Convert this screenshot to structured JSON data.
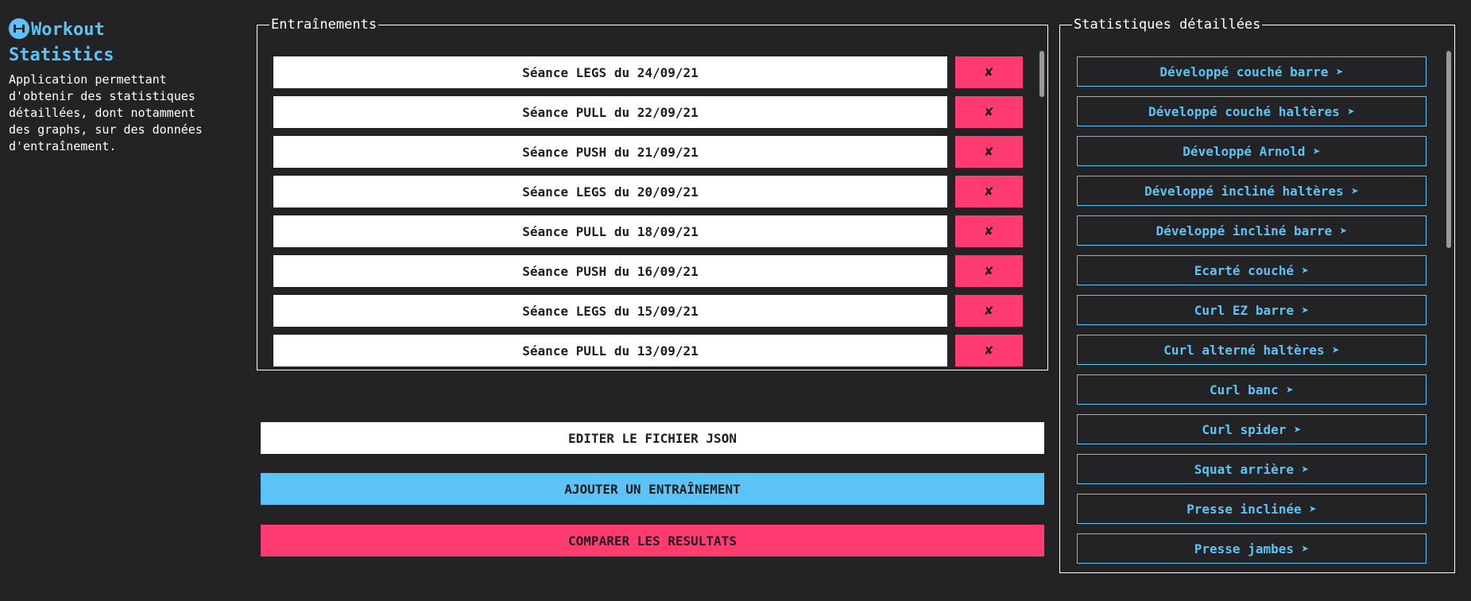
{
  "app": {
    "title": "Workout Statistics",
    "description": "Application permettant d'obtenir des statistiques détaillées, dont notamment des graphs, sur des données d'entraînement.",
    "logo_icon": "dumbbell-icon",
    "accent_color": "#5bc3f5",
    "danger_color": "#ff3b72"
  },
  "workouts_panel": {
    "legend": "Entraînements",
    "delete_label": "✘",
    "items": [
      {
        "label": "Séance LEGS du 24/09/21"
      },
      {
        "label": "Séance PULL du 22/09/21"
      },
      {
        "label": "Séance PUSH du 21/09/21"
      },
      {
        "label": "Séance LEGS du 20/09/21"
      },
      {
        "label": "Séance PULL du 18/09/21"
      },
      {
        "label": "Séance PUSH du 16/09/21"
      },
      {
        "label": "Séance LEGS du 15/09/21"
      },
      {
        "label": "Séance PULL du 13/09/21"
      },
      {
        "label": ""
      }
    ]
  },
  "stats_panel": {
    "legend": "Statistiques détaillées",
    "items": [
      {
        "label": "Développé couché barre ➤"
      },
      {
        "label": "Développé couché haltères ➤"
      },
      {
        "label": "Développé Arnold ➤"
      },
      {
        "label": "Développé incliné haltères ➤"
      },
      {
        "label": "Développé incliné barre ➤"
      },
      {
        "label": "Ecarté couché ➤"
      },
      {
        "label": "Curl EZ barre ➤"
      },
      {
        "label": "Curl alterné haltères ➤"
      },
      {
        "label": "Curl banc ➤"
      },
      {
        "label": "Curl spider ➤"
      },
      {
        "label": "Squat arrière ➤"
      },
      {
        "label": "Presse inclinée ➤"
      },
      {
        "label": "Presse jambes ➤"
      },
      {
        "label": ""
      }
    ]
  },
  "actions": {
    "edit_json": "EDITER LE FICHIER JSON",
    "add_workout": "AJOUTER UN ENTRAÎNEMENT",
    "compare": "COMPARER LES RESULTATS"
  }
}
